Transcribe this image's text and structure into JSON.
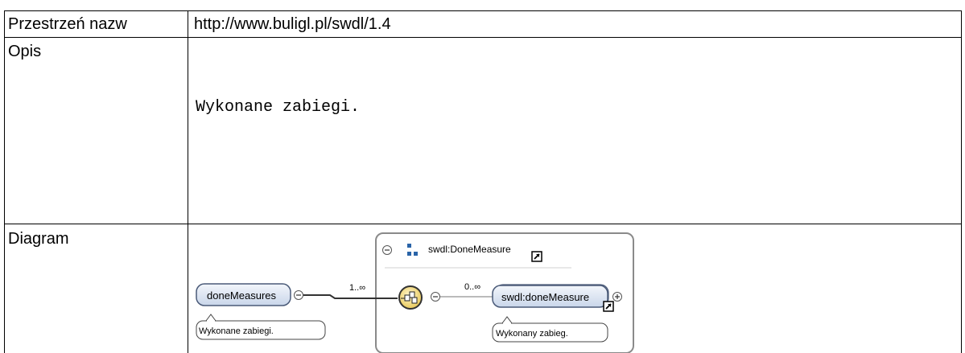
{
  "rows": {
    "namespace": {
      "label": "Przestrzeń nazw",
      "value": "http://www.buligl.pl/swdl/1.4"
    },
    "description": {
      "label": "Opis",
      "value": "Wykonane zabiegi."
    },
    "diagram": {
      "label": "Diagram"
    }
  },
  "diagram": {
    "root_element": "doneMeasures",
    "root_annotation": "Wykonane zabiegi.",
    "root_cardinality": "1..∞",
    "type_name": "swdl:DoneMeasure",
    "child_cardinality": "0..∞",
    "child_element": "swdl:doneMeasure",
    "child_annotation": "Wykonany zabieg."
  },
  "colors": {
    "element_fill": "#dde6f3",
    "element_stroke": "#4a5a78",
    "type_box_stroke": "#8a8a8a",
    "sequence_fill": "#f6e39a",
    "line": "#333333"
  },
  "icons": [
    "collapse-minus-icon",
    "type-structure-icon",
    "link-arrow-icon",
    "sequence-icon",
    "expand-plus-icon"
  ]
}
